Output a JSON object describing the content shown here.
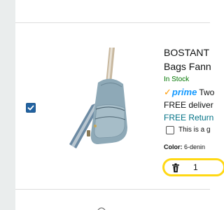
{
  "product": {
    "title_line1": "BOSTANT",
    "title_line2": "Bags Fann",
    "stock": "In Stock",
    "prime_label": "prime",
    "prime_delivery": "Two",
    "free_delivery": "FREE deliver",
    "free_returns": "FREE Return",
    "gift_label": "This is a g",
    "color_label": "Color:",
    "color_value": "6-denin",
    "quantity": "1",
    "selected": true
  },
  "icons": {
    "prime_check": "prime-checkmark-icon",
    "trash": "trash-icon",
    "select_checkbox": "checkmark-icon"
  },
  "colors": {
    "in_stock": "#007600",
    "prime_blue": "#1399ff",
    "prime_orange": "#ff9900",
    "link_teal": "#007185",
    "quantity_border": "#ffd814",
    "checkbox_blue": "#2162a1"
  }
}
